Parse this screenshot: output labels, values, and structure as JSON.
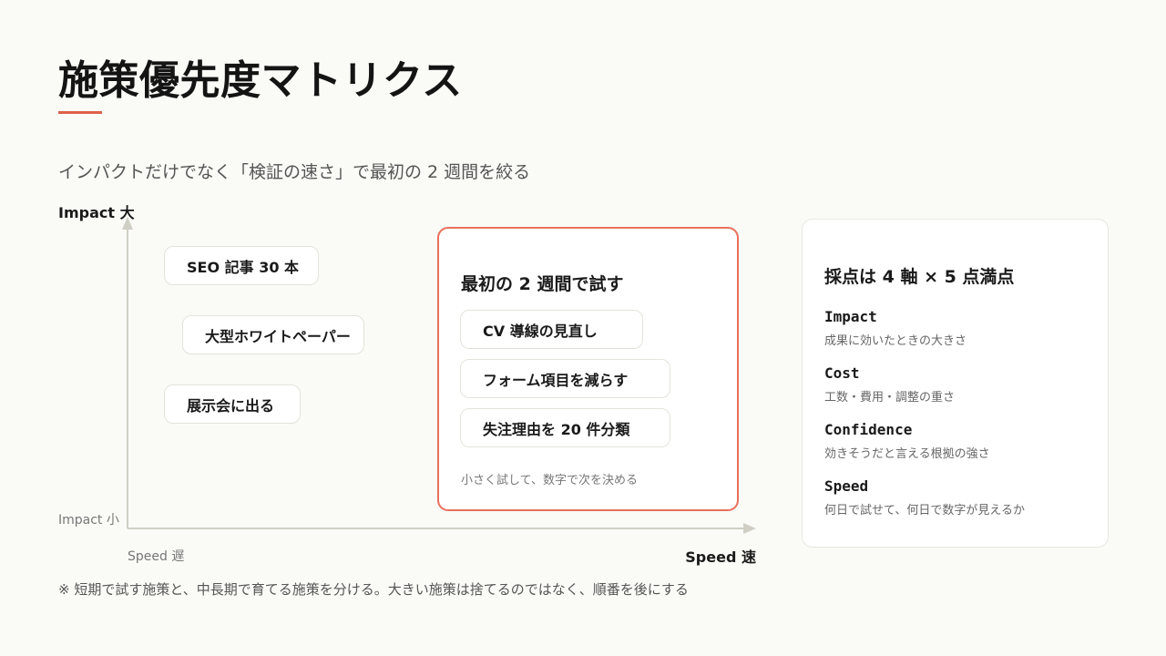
{
  "title": "施策優先度マトリクス",
  "subtitle": "インパクトだけでなく「検証の速さ」で最初の 2 週間を絞る",
  "axes": {
    "impact_high": "Impact 大",
    "impact_low": "Impact 小",
    "speed_slow": "Speed 遅",
    "speed_fast": "Speed 速"
  },
  "slow_items": [
    "SEO 記事 30 本",
    "大型ホワイトペーパー",
    "展示会に出る"
  ],
  "focus": {
    "title": "最初の 2 週間で試す",
    "items": [
      "CV 導線の見直し",
      "フォーム項目を減らす",
      "失注理由を 20 件分類"
    ],
    "note": "小さく試して、数字で次を決める"
  },
  "scoring": {
    "title": "採点は 4 軸 × 5 点満点",
    "metrics": [
      {
        "name": "Impact",
        "desc": "成果に効いたときの大きさ"
      },
      {
        "name": "Cost",
        "desc": "工数・費用・調整の重さ"
      },
      {
        "name": "Confidence",
        "desc": "効きそうだと言える根拠の強さ"
      },
      {
        "name": "Speed",
        "desc": "何日で試せて、何日で数字が見えるか"
      }
    ]
  },
  "footnote": "※ 短期で試す施策と、中長期で育てる施策を分ける。大きい施策は捨てるのではなく、順番を後にする",
  "colors": {
    "accent": "#e0604a",
    "axis": "#cfcfc5",
    "background": "#fafaf7"
  }
}
